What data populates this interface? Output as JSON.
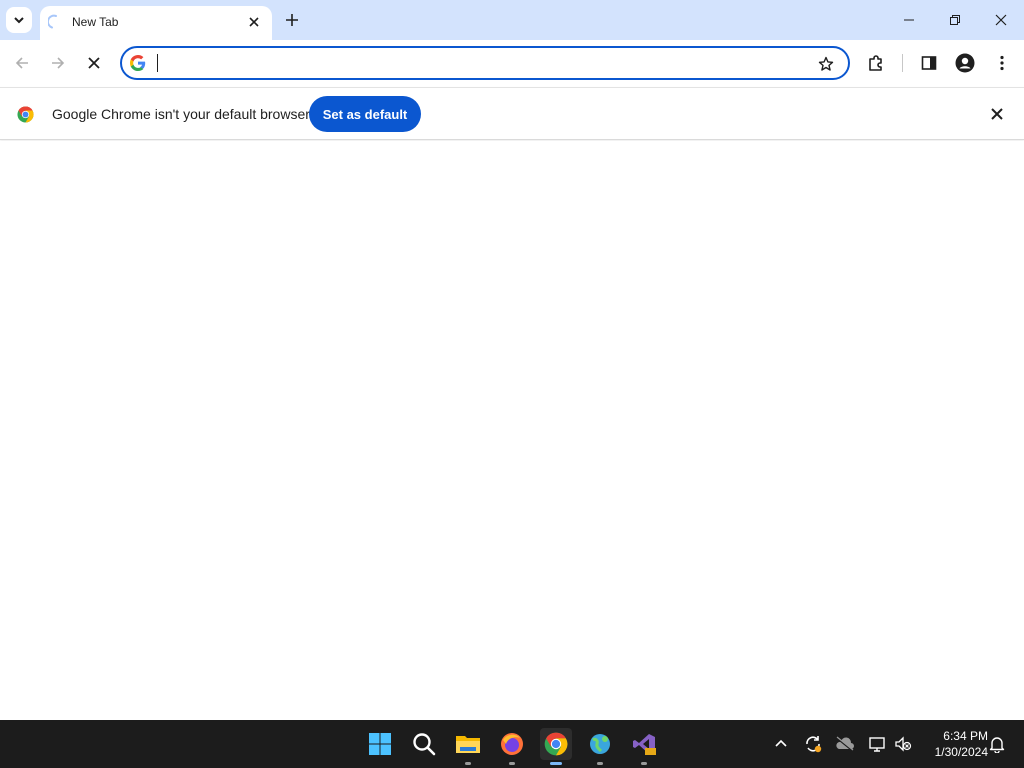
{
  "browser": {
    "tab": {
      "title": "New Tab",
      "loading": true
    },
    "omnibox": {
      "value": "",
      "placeholder": ""
    },
    "infobar": {
      "message": "Google Chrome isn't your default browser",
      "button_label": "Set as default"
    }
  },
  "taskbar": {
    "apps": [
      {
        "name": "start",
        "icon": "windows-icon"
      },
      {
        "name": "search",
        "icon": "search-icon"
      },
      {
        "name": "file-explorer",
        "icon": "folder-icon",
        "running": true
      },
      {
        "name": "firefox",
        "icon": "firefox-icon",
        "running": true
      },
      {
        "name": "chrome",
        "icon": "chrome-icon",
        "running": true,
        "active": true
      },
      {
        "name": "settings",
        "icon": "settings-globe-icon",
        "running": true
      },
      {
        "name": "visual-studio",
        "icon": "visual-studio-icon",
        "running": true
      }
    ],
    "clock": {
      "time": "6:34 PM",
      "date": "1/30/2024"
    }
  },
  "colors": {
    "tabstrip": "#d3e3fd",
    "accent": "#0b57d0",
    "taskbar": "#1c1c1c"
  }
}
